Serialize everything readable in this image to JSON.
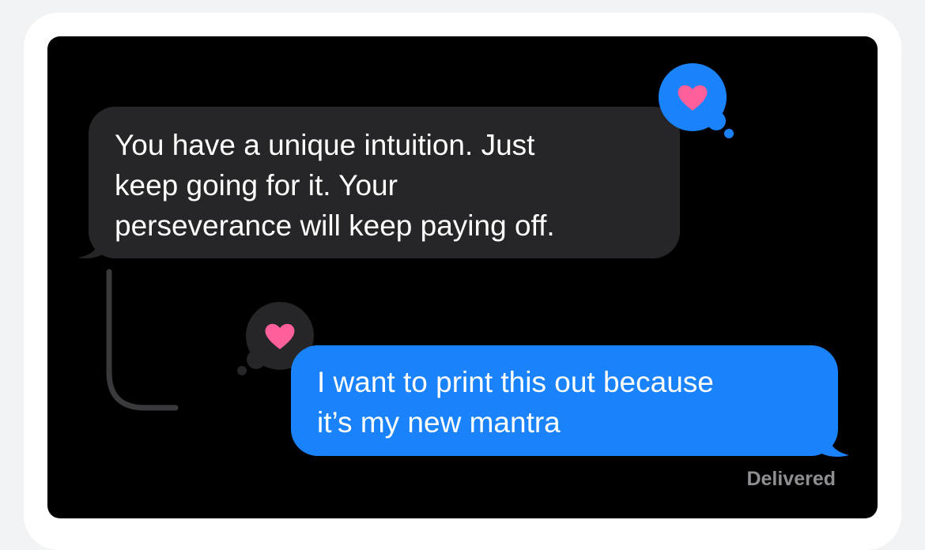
{
  "conversation": {
    "incoming_message": "You have a unique intuition. Just\nkeep going for it. Your\nperseverance will keep paying off.",
    "outgoing_message": "I want to print this out because\nit’s my new mantra",
    "status": "Delivered"
  },
  "reactions": {
    "incoming": "heart-icon",
    "outgoing": "heart-icon"
  },
  "colors": {
    "incoming_bubble": "#262628",
    "outgoing_bubble": "#1a82fb",
    "heart": "#ff5f9a",
    "background": "#000000"
  }
}
